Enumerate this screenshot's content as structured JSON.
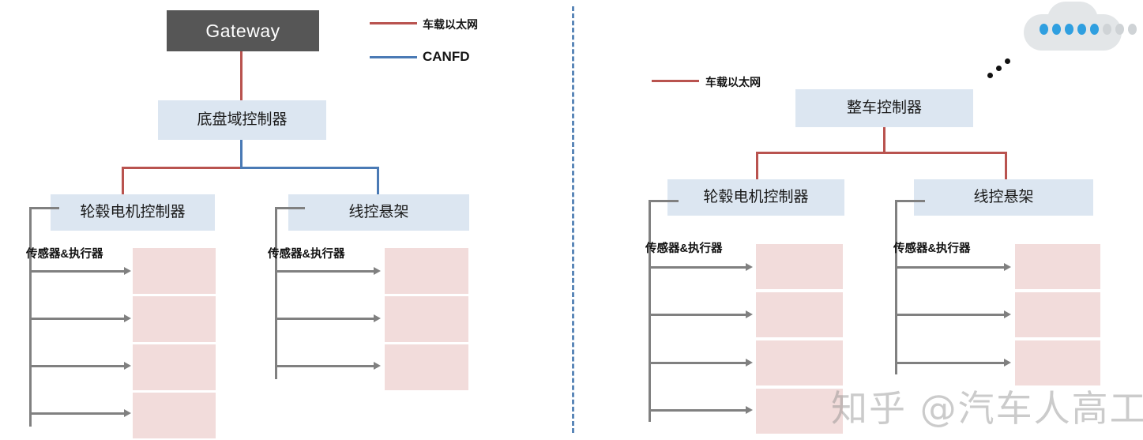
{
  "colors": {
    "ethernet": "#b9534f",
    "canfd": "#4a7ab5",
    "node_fill": "#dce6f1",
    "gateway_fill": "#565656",
    "sensor_fill": "#f2dcdb",
    "bracket": "#808080",
    "divider": "#5b87b8",
    "cloud_body": "#e3e6e8",
    "cloud_dot_active": "#2f9fe0",
    "cloud_dot_inactive": "#cfd3d6"
  },
  "left_panel": {
    "legend": [
      {
        "label": "车载以太网",
        "color_key": "ethernet",
        "icon": "line-swatch-icon"
      },
      {
        "label": "CANFD",
        "color_key": "canfd",
        "icon": "line-swatch-icon"
      }
    ],
    "gateway": {
      "label": "Gateway"
    },
    "domain_controller": {
      "label": "底盘域控制器"
    },
    "controllers": [
      {
        "label": "轮毂电机控制器",
        "sensor_label": "传感器&执行器",
        "sensor_count": 4
      },
      {
        "label": "线控悬架",
        "sensor_label": "传感器&执行器",
        "sensor_count": 3
      }
    ]
  },
  "right_panel": {
    "legend": [
      {
        "label": "车载以太网",
        "color_key": "ethernet",
        "icon": "line-swatch-icon"
      }
    ],
    "vehicle_controller": {
      "label": "整车控制器"
    },
    "controllers": [
      {
        "label": "轮毂电机控制器",
        "sensor_label": "传感器&执行器",
        "sensor_count": 4
      },
      {
        "label": "线控悬架",
        "sensor_label": "传感器&执行器",
        "sensor_count": 3
      }
    ],
    "cloud_icon": {
      "name": "cloud-icon",
      "active_dots": 5,
      "inactive_dots": 3
    },
    "ellipsis": {
      "name": "ellipsis-dots",
      "count": 3
    }
  },
  "watermark": {
    "text": "知乎 @汽车人高工"
  }
}
